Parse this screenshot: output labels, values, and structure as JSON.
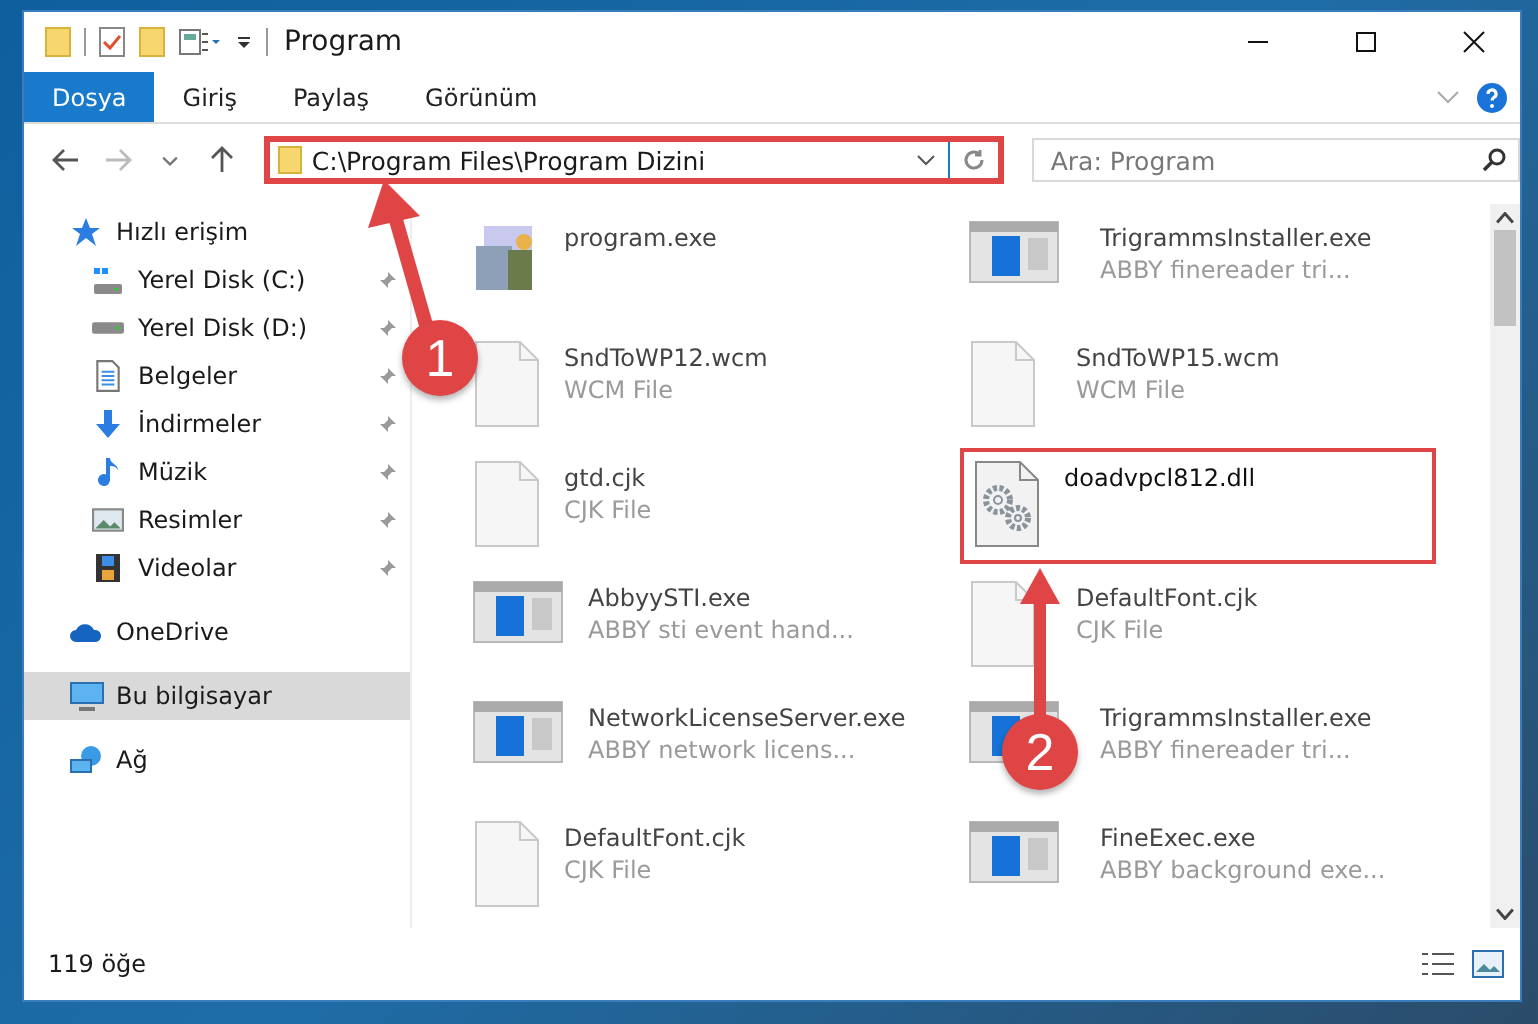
{
  "window": {
    "title": "Program"
  },
  "ribbon_tabs": [
    {
      "label": "Dosya",
      "selected": true
    },
    {
      "label": "Giriş",
      "selected": false
    },
    {
      "label": "Paylaş",
      "selected": false
    },
    {
      "label": "Görünüm",
      "selected": false
    }
  ],
  "address_bar": {
    "path": "C:\\Program Files\\Program Dizini",
    "highlighted": true
  },
  "search": {
    "placeholder": "Ara: Program"
  },
  "sidebar": {
    "items": [
      {
        "label": "Hızlı erişim",
        "kind": "star",
        "selected": false,
        "children": [
          {
            "label": "Yerel Disk (C:)",
            "kind": "system-drive",
            "pinned": true,
            "selected": false
          },
          {
            "label": "Yerel Disk (D:)",
            "kind": "drive",
            "pinned": true,
            "selected": false
          },
          {
            "label": "Belgeler",
            "kind": "documents",
            "pinned": true,
            "selected": false
          },
          {
            "label": "İndirmeler",
            "kind": "downloads",
            "pinned": true,
            "selected": false
          },
          {
            "label": "Müzik",
            "kind": "music",
            "pinned": true,
            "selected": false
          },
          {
            "label": "Resimler",
            "kind": "pictures",
            "pinned": true,
            "selected": false
          },
          {
            "label": "Videolar",
            "kind": "videos",
            "pinned": true,
            "selected": false
          }
        ]
      },
      {
        "label": "OneDrive",
        "kind": "cloud",
        "selected": false
      },
      {
        "label": "Bu bilgisayar",
        "kind": "computer",
        "selected": true
      },
      {
        "label": "Ağ",
        "kind": "network",
        "selected": false
      }
    ]
  },
  "files": [
    {
      "name": "program.exe",
      "kind": "application",
      "highlighted": false
    },
    {
      "name": "TrigrammsInstaller.exe",
      "type": "ABBY finereader tri...",
      "kind": "program",
      "highlighted": false
    },
    {
      "name": "SndToWP12.wcm",
      "type": "WCM File",
      "kind": "file",
      "highlighted": false
    },
    {
      "name": "SndToWP15.wcm",
      "type": "WCM File",
      "kind": "file",
      "highlighted": false
    },
    {
      "name": "gtd.cjk",
      "type": "CJK File",
      "kind": "file",
      "highlighted": false
    },
    {
      "name": "doadvpcl812.dll",
      "kind": "library",
      "highlighted": true
    },
    {
      "name": "AbbyySTI.exe",
      "type": "ABBY sti event hand...",
      "kind": "program",
      "highlighted": false
    },
    {
      "name": "DefaultFont.cjk",
      "type": "CJK File",
      "kind": "file",
      "highlighted": false
    },
    {
      "name": "NetworkLicenseServer.exe",
      "type": "ABBY network licens...",
      "kind": "program",
      "highlighted": false
    },
    {
      "name": "TrigrammsInstaller.exe",
      "type": "ABBY finereader tri...",
      "kind": "program",
      "highlighted": false
    },
    {
      "name": "DefaultFont.cjk",
      "type": "CJK File",
      "kind": "file",
      "highlighted": false
    },
    {
      "name": "FineExec.exe",
      "type": "ABBY background exe...",
      "kind": "program",
      "highlighted": false
    }
  ],
  "status_bar": {
    "item_count": "119 öğe"
  },
  "annotations": [
    {
      "number": "1"
    },
    {
      "number": "2"
    }
  ]
}
